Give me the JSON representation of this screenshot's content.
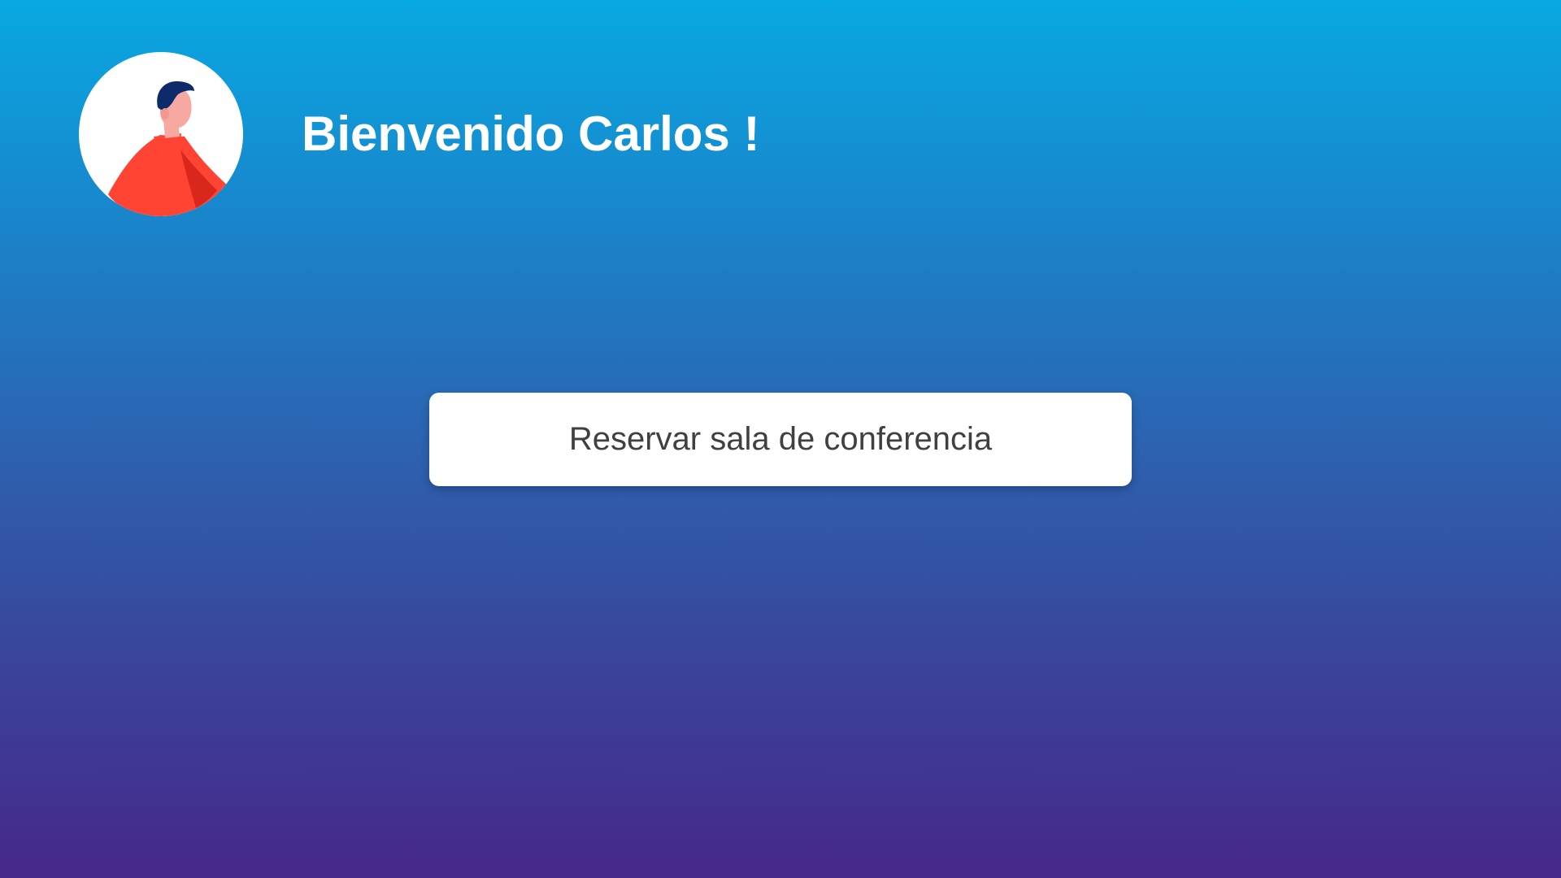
{
  "user": {
    "avatar_icon": "person-avatar-icon",
    "welcome_text": "Bienvenido Carlos !"
  },
  "actions": {
    "book_room_label": "Reservar sala de conferencia"
  },
  "colors": {
    "background_top": "#08a8e2",
    "background_bottom": "#46288a",
    "avatar_shirt": "#ff4433",
    "avatar_hair": "#0d2a6b",
    "avatar_skin": "#f7a8a0",
    "button_text": "#404040"
  }
}
